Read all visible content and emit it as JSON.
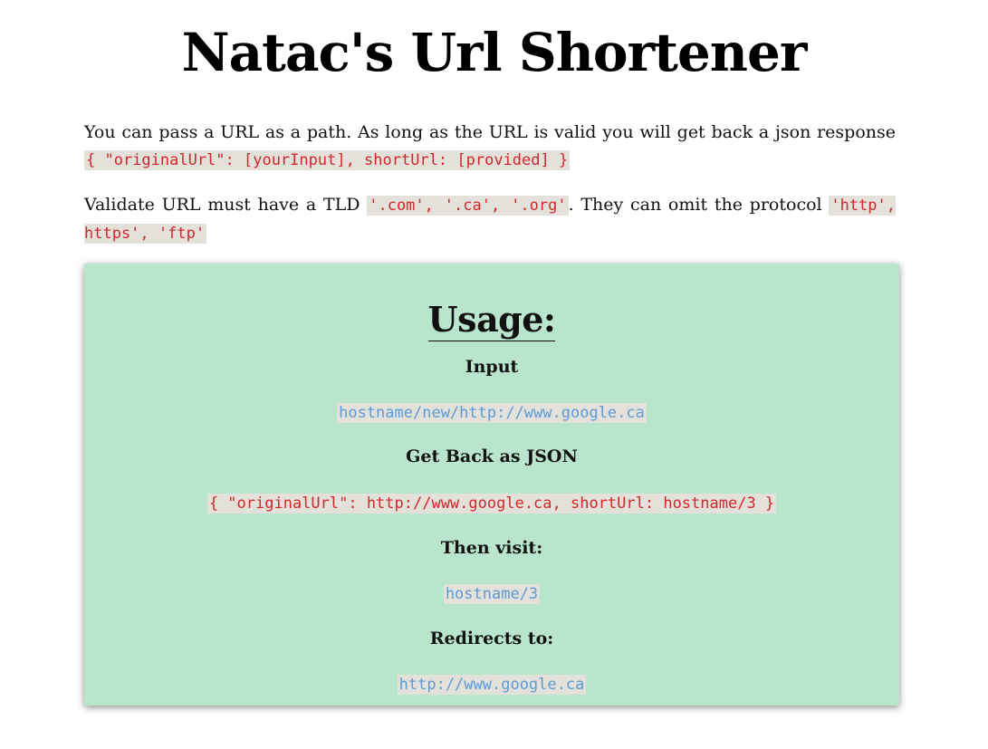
{
  "title": "Natac's Url Shortener",
  "intro": {
    "p1_text": "You can pass a URL as a path. As long as the URL is valid you will get back a json response ",
    "p1_code": "{ \"originalUrl\": [yourInput], shortUrl: [provided] }",
    "p2_text_a": "Validate URL must have a TLD ",
    "p2_code_a": "'.com', '.ca', '.org'",
    "p2_text_b": ". They can omit the protocol ",
    "p2_code_b": "'http', https', 'ftp'"
  },
  "usage": {
    "heading": "Usage:",
    "input_label": "Input",
    "input_example": "hostname/new/http://www.google.ca",
    "json_label": "Get Back as JSON",
    "json_example": "{ \"originalUrl\": http://www.google.ca, shortUrl: hostname/3 }",
    "visit_label": "Then visit:",
    "visit_example": "hostname/3",
    "redirect_label": "Redirects to:",
    "redirect_example": "http://www.google.ca"
  },
  "colors": {
    "card_background": "#b9e5cd",
    "code_background": "#e4e1da",
    "code_red": "#d0282c",
    "code_blue": "#5b9bd8"
  }
}
